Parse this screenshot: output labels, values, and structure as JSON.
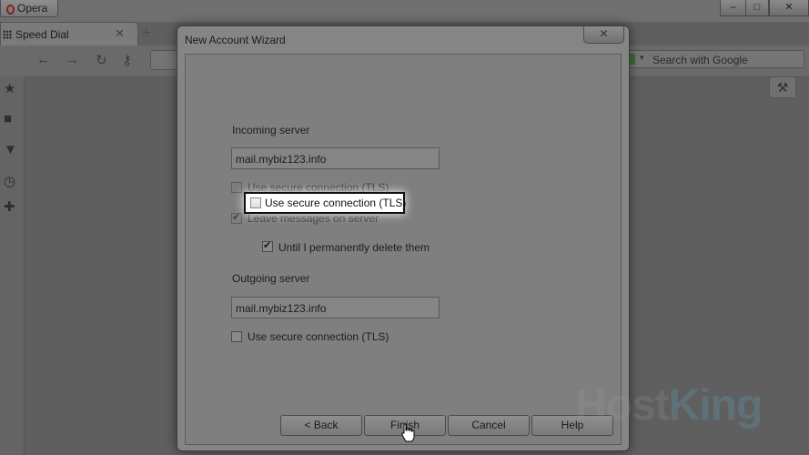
{
  "browser": {
    "menu_label": "Opera",
    "tab_label": "Speed Dial",
    "new_tab_symbol": "+",
    "search_placeholder": "Search with Google",
    "minimize_symbol": "–",
    "maximize_symbol": "□",
    "close_symbol": "✕"
  },
  "dialog": {
    "title": "New Account Wizard",
    "close_symbol": "✕",
    "incoming": {
      "heading": "Incoming server",
      "server_value": "mail.mybiz123.info",
      "tls_label": "Use secure connection (TLS)",
      "tls_checked": false,
      "leave_label": "Leave messages on server",
      "leave_checked": true,
      "until_label": "Until I permanently delete them",
      "until_checked": true
    },
    "outgoing": {
      "heading": "Outgoing server",
      "server_value": "mail.mybiz123.info",
      "tls_label": "Use secure connection (TLS)",
      "tls_checked": false
    },
    "buttons": {
      "back": "< Back",
      "finish": "Finish",
      "cancel": "Cancel",
      "help": "Help"
    }
  },
  "callout": {
    "label": "Use secure connection (TLS)",
    "checked": false
  },
  "watermark": {
    "part1": "Host",
    "part2": "King"
  },
  "icons": [
    "opera-logo-icon",
    "speed-dial-grid-icon",
    "back-arrow-icon",
    "forward-arrow-icon",
    "reload-icon",
    "key-icon",
    "star-icon",
    "notes-icon",
    "downloads-icon",
    "history-icon",
    "plus-icon",
    "wrench-icon",
    "google-icon",
    "mouse-cursor-icon"
  ]
}
